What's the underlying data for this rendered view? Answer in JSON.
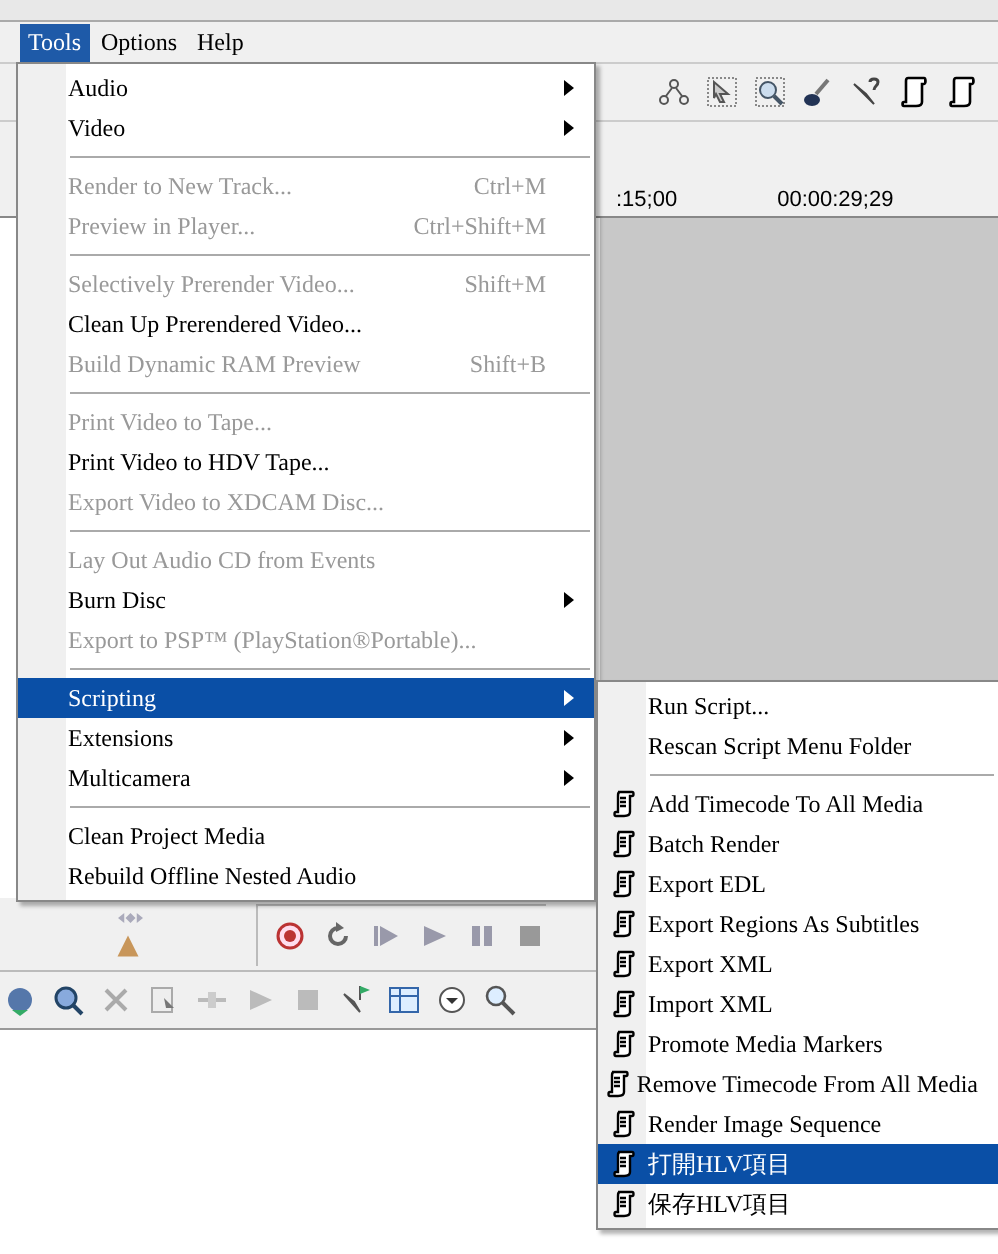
{
  "menubar": [
    {
      "label": "Tools",
      "selected": true
    },
    {
      "label": "Options",
      "selected": false
    },
    {
      "label": "Help",
      "selected": false
    }
  ],
  "timeline": {
    "ruler_labels": [
      ":15;00",
      "00:00:29;29"
    ]
  },
  "tools_menu": [
    {
      "kind": "item",
      "label": "Audio",
      "submenu": true,
      "disabled": false,
      "selected": false
    },
    {
      "kind": "item",
      "label": "Video",
      "submenu": true,
      "disabled": false,
      "selected": false
    },
    {
      "kind": "separator"
    },
    {
      "kind": "item",
      "label": "Render to New Track...",
      "shortcut": "Ctrl+M",
      "disabled": true,
      "selected": false
    },
    {
      "kind": "item",
      "label": "Preview in Player...",
      "shortcut": "Ctrl+Shift+M",
      "disabled": true,
      "selected": false
    },
    {
      "kind": "separator"
    },
    {
      "kind": "item",
      "label": "Selectively Prerender Video...",
      "shortcut": "Shift+M",
      "disabled": true,
      "selected": false
    },
    {
      "kind": "item",
      "label": "Clean Up Prerendered Video...",
      "disabled": false,
      "selected": false
    },
    {
      "kind": "item",
      "label": "Build Dynamic RAM Preview",
      "shortcut": "Shift+B",
      "disabled": true,
      "selected": false
    },
    {
      "kind": "separator"
    },
    {
      "kind": "item",
      "label": "Print Video to Tape...",
      "disabled": true,
      "selected": false
    },
    {
      "kind": "item",
      "label": "Print Video to HDV Tape...",
      "disabled": false,
      "selected": false
    },
    {
      "kind": "item",
      "label": "Export Video to XDCAM Disc...",
      "disabled": true,
      "selected": false
    },
    {
      "kind": "separator"
    },
    {
      "kind": "item",
      "label": "Lay Out Audio CD from Events",
      "disabled": true,
      "selected": false
    },
    {
      "kind": "item",
      "label": "Burn Disc",
      "submenu": true,
      "disabled": false,
      "selected": false
    },
    {
      "kind": "item",
      "label": "Export to PSP™ (PlayStation®Portable)...",
      "disabled": true,
      "selected": false
    },
    {
      "kind": "separator"
    },
    {
      "kind": "item",
      "label": "Scripting",
      "submenu": true,
      "disabled": false,
      "selected": true
    },
    {
      "kind": "item",
      "label": "Extensions",
      "submenu": true,
      "disabled": false,
      "selected": false
    },
    {
      "kind": "item",
      "label": "Multicamera",
      "submenu": true,
      "disabled": false,
      "selected": false
    },
    {
      "kind": "separator"
    },
    {
      "kind": "item",
      "label": "Clean Project Media",
      "disabled": false,
      "selected": false
    },
    {
      "kind": "item",
      "label": "Rebuild Offline Nested Audio",
      "disabled": false,
      "selected": false
    }
  ],
  "scripting_menu": [
    {
      "kind": "item",
      "label": "Run Script...",
      "selected": false
    },
    {
      "kind": "item",
      "label": "Rescan Script Menu Folder",
      "selected": false
    },
    {
      "kind": "separator"
    },
    {
      "kind": "script",
      "label": "Add Timecode To All Media",
      "selected": false
    },
    {
      "kind": "script",
      "label": "Batch Render",
      "selected": false
    },
    {
      "kind": "script",
      "label": "Export EDL",
      "selected": false
    },
    {
      "kind": "script",
      "label": "Export Regions As Subtitles",
      "selected": false
    },
    {
      "kind": "script",
      "label": "Export XML",
      "selected": false
    },
    {
      "kind": "script",
      "label": "Import XML",
      "selected": false
    },
    {
      "kind": "script",
      "label": "Promote Media Markers",
      "selected": false
    },
    {
      "kind": "script",
      "label": "Remove Timecode From All Media",
      "selected": false
    },
    {
      "kind": "script",
      "label": "Render Image Sequence",
      "selected": false
    },
    {
      "kind": "script",
      "label": "打開HLV項目",
      "selected": true
    },
    {
      "kind": "script",
      "label": "保存HLV項目",
      "selected": false
    }
  ]
}
